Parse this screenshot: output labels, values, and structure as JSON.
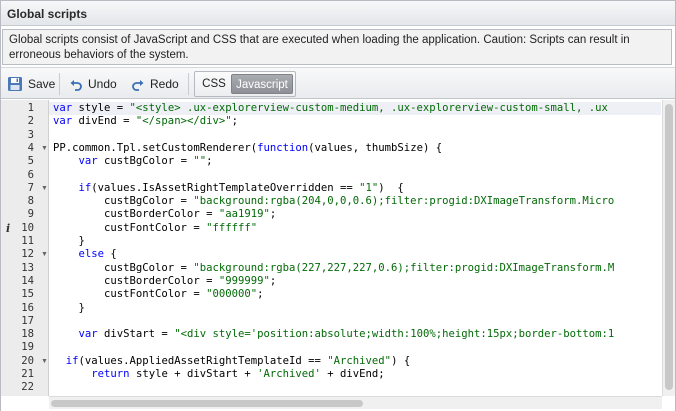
{
  "window": {
    "title": "Global scripts"
  },
  "info": {
    "text": "Global scripts consist of JavaScript and CSS that are executed when loading the application. Caution: Scripts can result in erroneous behaviors of the system."
  },
  "toolbar": {
    "save_label": "Save",
    "undo_label": "Undo",
    "redo_label": "Redo",
    "tabs": [
      {
        "label": "CSS",
        "selected": false
      },
      {
        "label": "Javascript",
        "selected": true
      }
    ],
    "icons": {
      "save": "save-icon",
      "undo": "undo-icon",
      "redo": "redo-icon"
    }
  },
  "editor": {
    "active_line": 1,
    "lines": [
      {
        "n": "1",
        "text": "var style = \"<style> .ux-explorerview-custom-medium, .ux-explorerview-custom-small, .ux"
      },
      {
        "n": "2",
        "text": "var divEnd = \"</span></div>\";"
      },
      {
        "n": "3",
        "text": ""
      },
      {
        "n": "4",
        "text": "PP.common.Tpl.setCustomRenderer(function(values, thumbSize) {",
        "fold": true
      },
      {
        "n": "5",
        "text": "    var custBgColor = \"\";"
      },
      {
        "n": "6",
        "text": ""
      },
      {
        "n": "7",
        "text": "    if(values.IsAssetRightTemplateOverridden == \"1\")  {",
        "fold": true
      },
      {
        "n": "8",
        "text": "        custBgColor = \"background:rgba(204,0,0,0.6);filter:progid:DXImageTransform.Micro"
      },
      {
        "n": "9",
        "text": "        custBorderColor = \"aa1919\";"
      },
      {
        "n": "10",
        "text": "        custFontColor = \"ffffff\"",
        "info": true
      },
      {
        "n": "11",
        "text": "    }"
      },
      {
        "n": "12",
        "text": "    else {",
        "fold": true
      },
      {
        "n": "13",
        "text": "        custBgColor = \"background:rgba(227,227,227,0.6);filter:progid:DXImageTransform.M"
      },
      {
        "n": "14",
        "text": "        custBorderColor = \"999999\";"
      },
      {
        "n": "15",
        "text": "        custFontColor = \"000000\";"
      },
      {
        "n": "16",
        "text": "    }"
      },
      {
        "n": "17",
        "text": ""
      },
      {
        "n": "18",
        "text": "    var divStart = \"<div style='position:absolute;width:100%;height:15px;border-bottom:1"
      },
      {
        "n": "19",
        "text": ""
      },
      {
        "n": "20",
        "text": "  if(values.AppliedAssetRightTemplateId == \"Archived\") {",
        "fold": true
      },
      {
        "n": "21",
        "text": "      return style + divStart + 'Archived' + divEnd;"
      },
      {
        "n": "22",
        "text": ""
      }
    ]
  }
}
